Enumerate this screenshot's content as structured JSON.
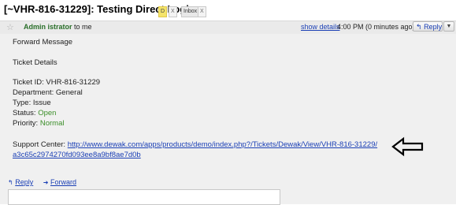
{
  "subject": {
    "title": "[~VHR-816-31229]: Testing Direct Login",
    "labels": [
      {
        "text": "D",
        "remove": "X"
      },
      {
        "text": "Inbox",
        "remove": "X"
      }
    ]
  },
  "message": {
    "sender": "Admin istrator",
    "recipient": "to me",
    "show_details": "show details",
    "time": "4:00 PM (0 minutes ago)",
    "reply_label": "Reply",
    "body": {
      "line1": "Forward Message",
      "line2": "Ticket Details",
      "ticket_id_label": "Ticket ID:",
      "ticket_id": "VHR-816-31229",
      "department_label": "Department:",
      "department": "General",
      "type_label": "Type:",
      "type": "Issue",
      "status_label": "Status:",
      "status": "Open",
      "priority_label": "Priority:",
      "priority": "Normal",
      "support_label": "Support Center:",
      "support_url_line1": "http://www.dewak.com/apps/products/demo/index.php?/Tickets/Dewak/View/VHR-816-31229/",
      "support_url_line2": "a3c65c2974270fd093ee8a9bf8ae7d0b"
    },
    "actions": {
      "reply": "Reply",
      "forward": "Forward"
    }
  },
  "colors": {
    "link": "#1a3fb5",
    "sender": "#2a6f2a",
    "status": "#3c8f2a"
  }
}
